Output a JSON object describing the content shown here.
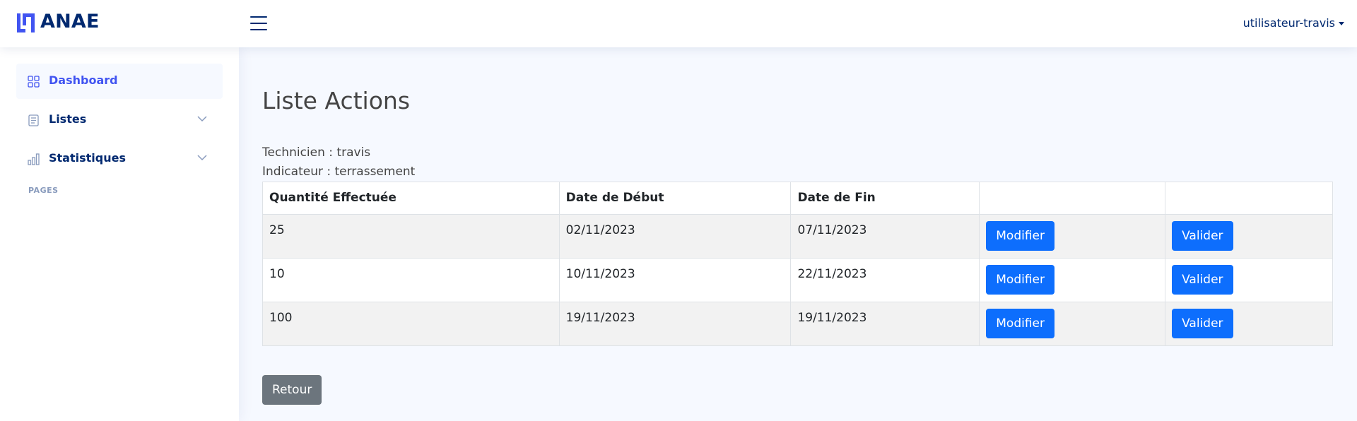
{
  "brand": {
    "name": "ANAE"
  },
  "header": {
    "user": "utilisateur-travis"
  },
  "sidebar": {
    "items": [
      {
        "label": "Dashboard",
        "icon": "grid-icon"
      },
      {
        "label": "Listes",
        "icon": "list-icon"
      },
      {
        "label": "Statistiques",
        "icon": "bar-chart-icon"
      }
    ],
    "heading": "PAGES"
  },
  "main": {
    "title": "Liste Actions",
    "technicien": "Technicien : travis",
    "indicateur": "Indicateur : terrassement",
    "table": {
      "headers": [
        "Quantité Effectuée",
        "Date de Début",
        "Date de Fin",
        "",
        ""
      ],
      "rows": [
        {
          "quantite": "25",
          "debut": "02/11/2023",
          "fin": "07/11/2023",
          "modifier": "Modifier",
          "valider": "Valider"
        },
        {
          "quantite": "10",
          "debut": "10/11/2023",
          "fin": "22/11/2023",
          "modifier": "Modifier",
          "valider": "Valider"
        },
        {
          "quantite": "100",
          "debut": "19/11/2023",
          "fin": "19/11/2023",
          "modifier": "Modifier",
          "valider": "Valider"
        }
      ]
    },
    "retour": "Retour"
  },
  "colors": {
    "brand": "#012970",
    "accent": "#4154f1",
    "primary": "#0d6efd",
    "secondary": "#6c757d"
  }
}
